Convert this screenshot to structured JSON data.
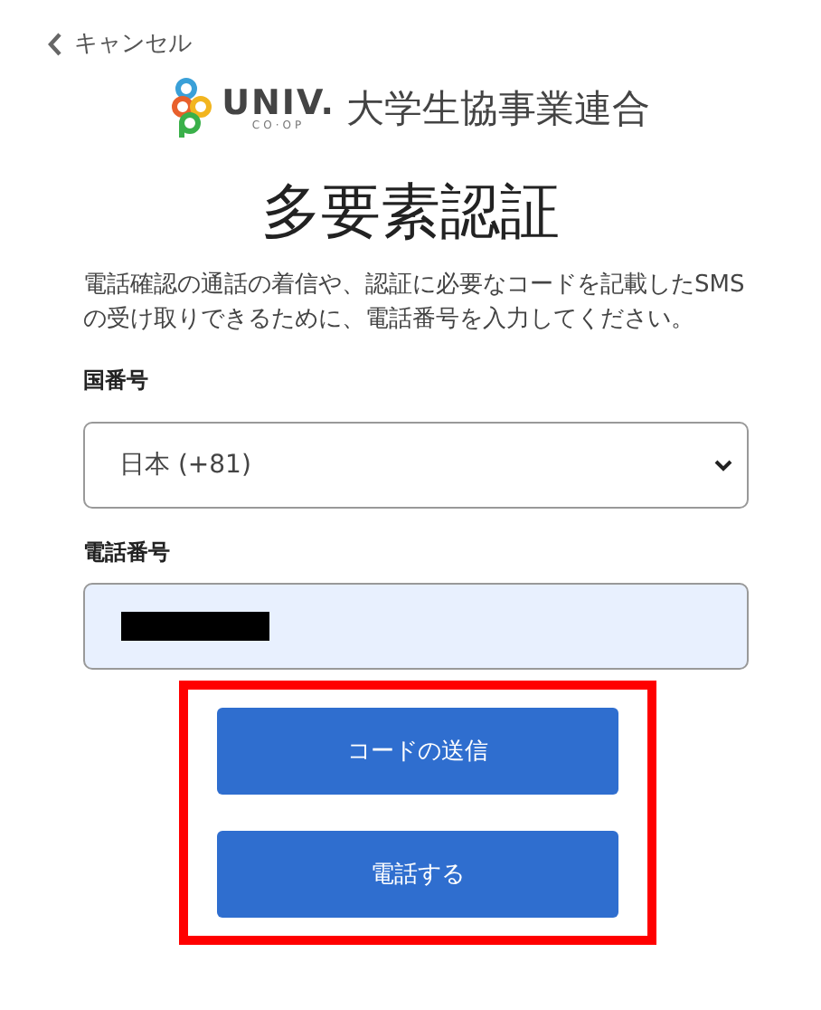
{
  "cancel": {
    "label": "キャンセル"
  },
  "logo": {
    "wordmark": "UNIV.",
    "sub": "CO·OP",
    "name": "大学生協事業連合"
  },
  "title": "多要素認証",
  "description": "電話確認の通話の着信や、認証に必要なコードを記載したSMS の受け取りできるために、電話番号を入力してください。",
  "country": {
    "label": "国番号",
    "value": "日本 (+81)"
  },
  "phone": {
    "label": "電話番号",
    "redacted": true
  },
  "buttons": [
    {
      "label": "コードの送信"
    },
    {
      "label": "電話する"
    }
  ],
  "highlight": true
}
